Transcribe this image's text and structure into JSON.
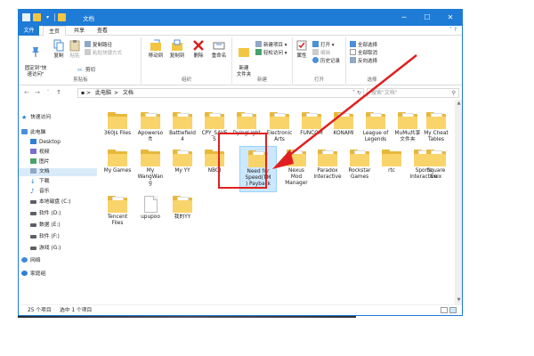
{
  "window": {
    "title": "文档",
    "controls": {
      "minimize": "─",
      "maximize": "☐",
      "close": "✕"
    }
  },
  "ribbon_tabs": [
    {
      "label": "文件",
      "active": false
    },
    {
      "label": "主页",
      "active": true
    },
    {
      "label": "共享",
      "active": false
    },
    {
      "label": "查看",
      "active": false
    }
  ],
  "ribbon": {
    "clipboard": {
      "label": "剪贴板",
      "pin": "固定到\"快\n速访问\"",
      "copy": "复制",
      "paste": "粘贴",
      "copy_path": "复制路径",
      "paste_shortcut": "粘贴快捷方式",
      "cut": "剪切"
    },
    "organize": {
      "label": "组织",
      "move_to": "移动到",
      "copy_to": "复制到",
      "delete": "删除",
      "rename": "重命名"
    },
    "new": {
      "label": "新建",
      "new_folder": "新建\n文件夹",
      "new_item": "新建项目",
      "easy_access": "轻松访问"
    },
    "open": {
      "label": "打开",
      "properties": "属性",
      "open": "打开",
      "edit": "编辑",
      "history": "历史记录"
    },
    "select": {
      "label": "选择",
      "select_all": "全部选择",
      "select_none": "全部取消",
      "invert": "反向选择"
    }
  },
  "address": {
    "path": [
      "此电脑",
      "文档"
    ],
    "search_placeholder": "搜索\"文档\""
  },
  "nav_pane": [
    {
      "label": "快速访问",
      "icon": "star-icon"
    },
    {
      "label": "此电脑",
      "icon": "computer-icon"
    },
    {
      "label": "Desktop",
      "icon": "desktop-icon"
    },
    {
      "label": "视频",
      "icon": "video-icon"
    },
    {
      "label": "图片",
      "icon": "pictures-icon"
    },
    {
      "label": "文档",
      "icon": "documents-icon",
      "selected": true
    },
    {
      "label": "下载",
      "icon": "download-icon"
    },
    {
      "label": "音乐",
      "icon": "music-icon"
    },
    {
      "label": "本地磁盘 (C:)",
      "icon": "drive-icon"
    },
    {
      "label": "软件 (D:)",
      "icon": "drive-icon"
    },
    {
      "label": "数据 (E:)",
      "icon": "drive-icon"
    },
    {
      "label": "软件 (F:)",
      "icon": "drive-icon"
    },
    {
      "label": "游戏 (G:)",
      "icon": "drive-icon"
    },
    {
      "label": "网络",
      "icon": "network-icon"
    },
    {
      "label": "家庭组",
      "icon": "homegroup-icon"
    }
  ],
  "folders_row1": [
    {
      "name": "360js Files"
    },
    {
      "name": "Apowerso\nft"
    },
    {
      "name": "Battlefield\n4"
    },
    {
      "name": "CPY_SAVE\nS"
    },
    {
      "name": "DyingLight"
    },
    {
      "name": "Electronic\nArts"
    },
    {
      "name": "FUNCOM"
    },
    {
      "name": "KONAMI"
    },
    {
      "name": "League of\nLegends"
    },
    {
      "name": "MuMu共享\n文件夹"
    },
    {
      "name": "My Cheat\nTables"
    }
  ],
  "folders_row2": [
    {
      "name": "My Games"
    },
    {
      "name": "My\nWangWan\ng"
    },
    {
      "name": "My YY"
    },
    {
      "name": "NBGI"
    },
    {
      "name": "Need for\nSpeed(TM\n) Payback",
      "selected": true
    },
    {
      "name": "Nexus\nMod\nManager"
    },
    {
      "name": "Paradox\nInteractive"
    },
    {
      "name": "Rockstar\nGames"
    },
    {
      "name": "rtc"
    },
    {
      "name": "Sports\nInteractive"
    },
    {
      "name": "Square\nEnix"
    }
  ],
  "folders_row3": [
    {
      "name": "Tencent\nFiles"
    },
    {
      "name": "upupoo",
      "blank": true
    },
    {
      "name": "我的YY"
    }
  ],
  "status": {
    "item_count": "25 个项目",
    "selected": "选中 1 个项目"
  },
  "colors": {
    "accent": "#1e7bd6",
    "annotation": "#e02020",
    "folder": "#f9d46b"
  }
}
